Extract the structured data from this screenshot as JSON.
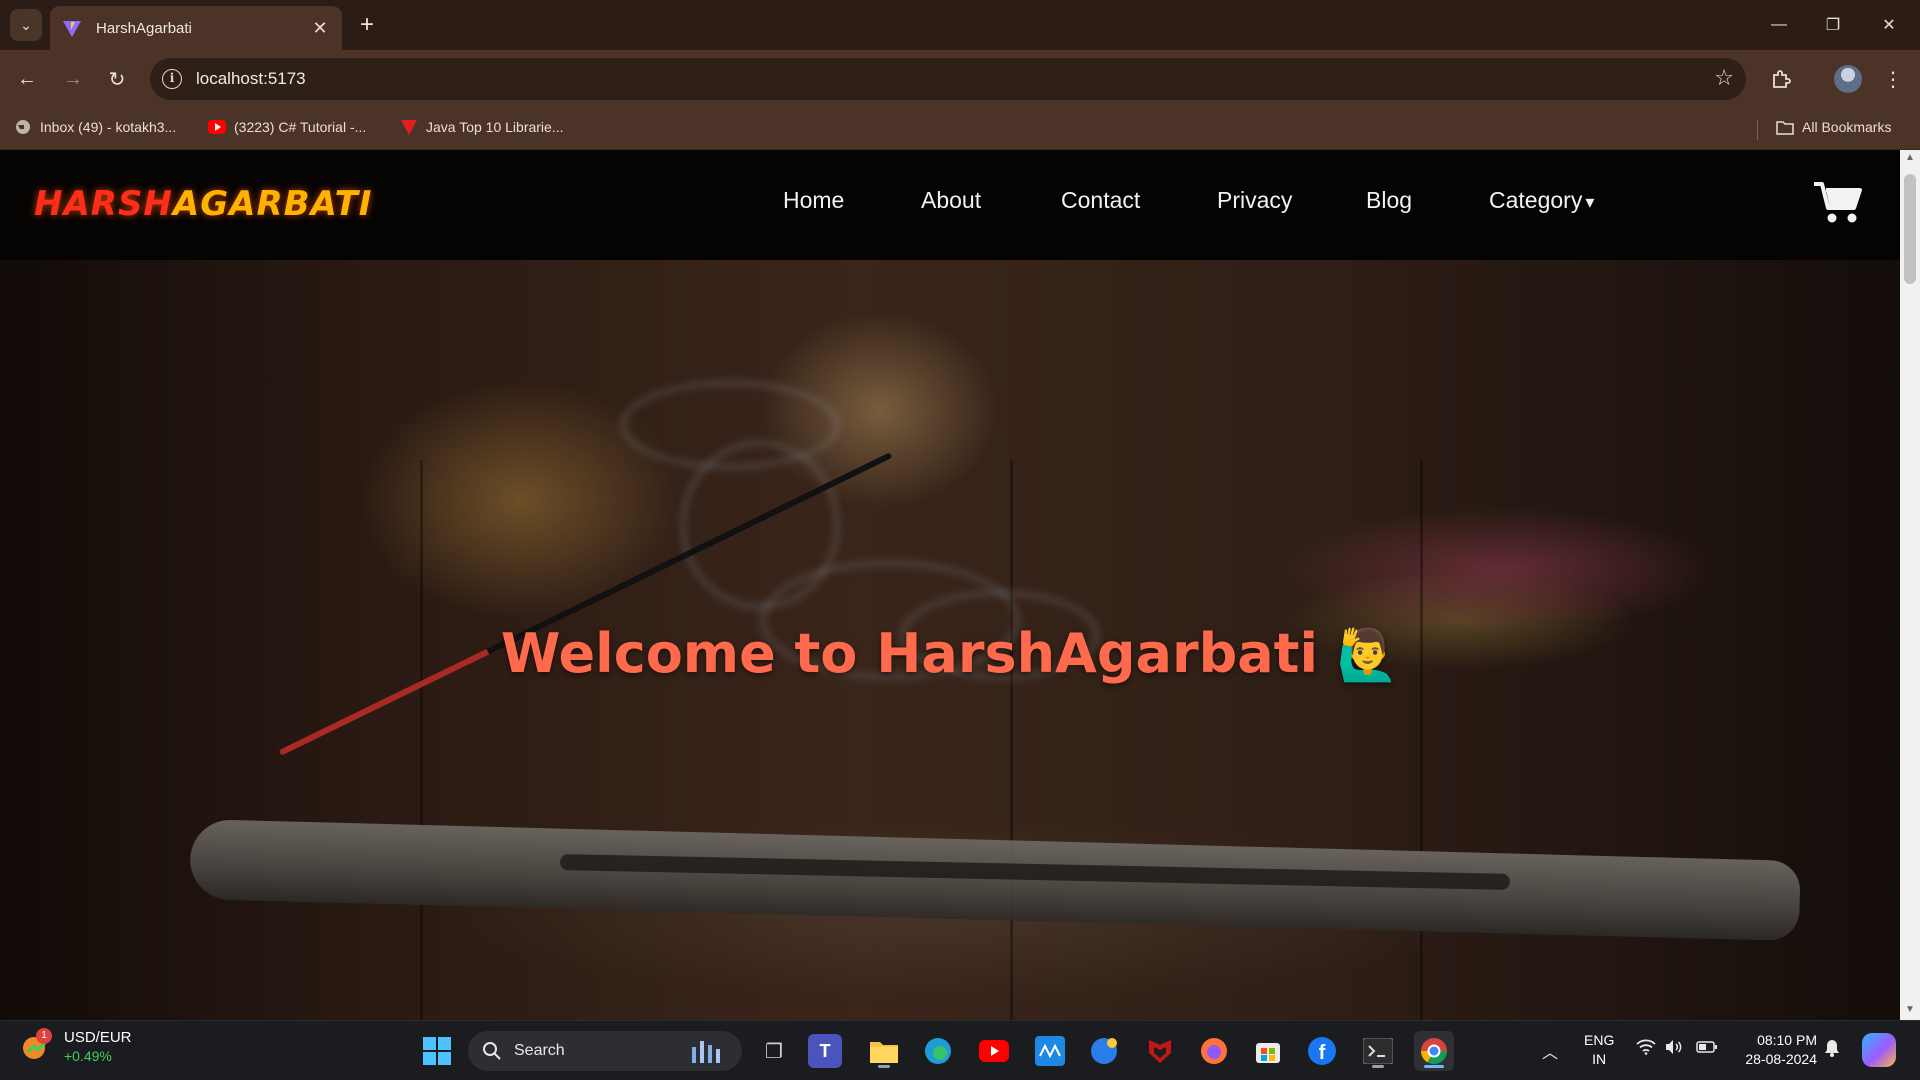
{
  "browser": {
    "tab_title": "HarshAgarbati",
    "url": "localhost:5173",
    "bookmarks": [
      {
        "label": "Inbox (49) - kotakh3...",
        "icon": "globe-icon"
      },
      {
        "label": "(3223) C# Tutorial -...",
        "icon": "youtube-icon"
      },
      {
        "label": "Java Top 10 Librarie...",
        "icon": "vite-icon"
      }
    ],
    "all_bookmarks": "All Bookmarks"
  },
  "site": {
    "brand_part1": "HARSH",
    "brand_part2": "AGARBATI",
    "nav": [
      "Home",
      "About",
      "Contact",
      "Privacy",
      "Blog",
      "Category"
    ],
    "category_caret": "▾",
    "hero_title": "Welcome to HarshAgarbati",
    "hero_emoji": "🙋‍♂️"
  },
  "taskbar": {
    "widget_pair": "USD/EUR",
    "widget_change": "+0.49%",
    "widget_badge": "1",
    "search_placeholder": "Search",
    "lang_top": "ENG",
    "lang_bottom": "IN",
    "time": "08:10 PM",
    "date": "28-08-2024"
  },
  "colors": {
    "brand_red": "#ff2d1a",
    "brand_orange": "#ffb300",
    "hero_title": "#ff6a4d",
    "chrome_brown": "#4b3328"
  }
}
